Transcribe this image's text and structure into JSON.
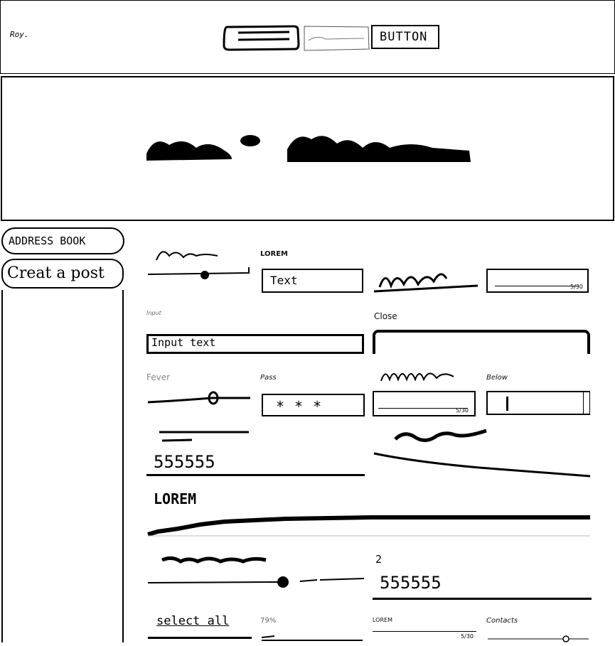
{
  "header": {
    "logo": "Roy.",
    "button_label": "BUTTON"
  },
  "nav": {
    "items": [
      {
        "label": "ADDRESS BOOK"
      },
      {
        "label": "Creat a post"
      }
    ]
  },
  "form": {
    "lorem_label": "LOREM",
    "lorem_field_value": "Text",
    "input_label": "Input",
    "input_value": "Input text",
    "close_label": "Close",
    "fever_label": "Fever",
    "pass_label": "Pass",
    "pass_value": "***",
    "below_label": "Below",
    "counter_a": "5/30",
    "counter_b": "5/30",
    "number_a": "555555",
    "heading_lorem": "LOREM",
    "number_b_label": "2",
    "number_b": "555555",
    "select_all": "select all",
    "percent": "79%",
    "lorem_small": "LOREM",
    "contacts_label": "Contacts",
    "counter_c": "5/30"
  }
}
